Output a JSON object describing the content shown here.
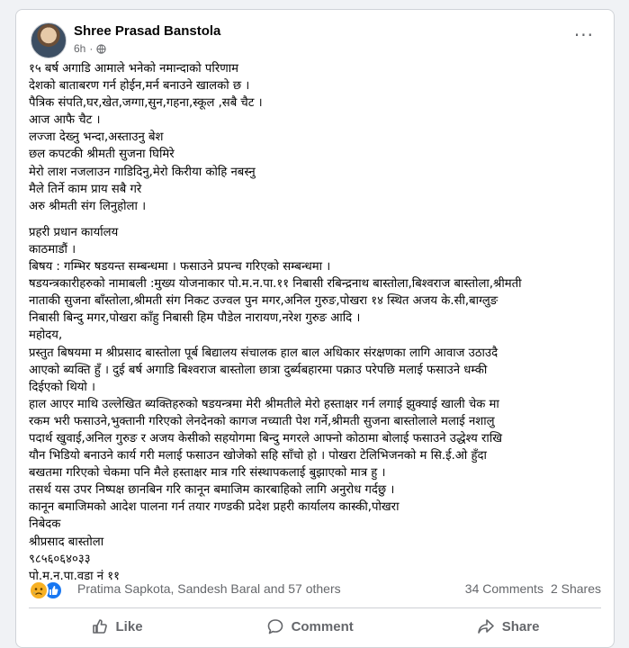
{
  "post": {
    "author": "Shree Prasad Banstola",
    "time": "6h",
    "dot": "·",
    "more": "···",
    "privacy_icon": "globe-icon",
    "lines": [
      "१५ बर्ष अगाडि आमाले भनेको नमान्दाको परिणाम",
      "देशको बाताबरण गर्न होईन,मर्न बनाउने खालको छ ।",
      "पैत्रिक संपति,घर,खेत,जग्गा,सुन,गहना,स्कूल ,सबै चैट ।",
      "आज आफै चैट ।",
      "लज्जा देख्नु भन्दा,अस्ताउनु बेश",
      "छल कपटकी श्रीमती सुजना घिमिरे",
      "मेरो लाश नजलाउन गाडिदिनु,मेरो किरीया कोहि नबस्नु",
      "मैले तिर्ने काम प्राय सबै गरे",
      "अरु श्रीमती संग लिनुहोला ।",
      "",
      "प्रहरी प्रधान कार्यालय",
      "काठमाडौं ।",
      "बिषय : गम्भिर षडयन्त सम्बन्धमा । फसाउने प्रपन्च गरिएको सम्बन्धमा ।",
      "षडयन्त्रकारीहरुको नामाबली :मुख्य योजनाकार पो.म.न.पा.११ निबासी रबिन्द्रनाथ बास्तोला,बिश्वराज बास्तोला,श्रीमती",
      "नाताकी सुजना बाँस्तोला,श्रीमती संग निकट उज्वल पुन मगर,अनिल गुरुङ,पोखरा १४ स्थित अजय के.सी,बाग्लुङ",
      "निबासी बिन्दु मगर,पोखरा काँहु निबासी हिम पौडेल नारायण,नरेश गुरुङ आदि ।",
      "महोदय,",
      "प्रस्तुत बिषयमा म श्रीप्रसाद बास्तोला पूर्ब बिद्यालय संचालक हाल बाल अधिकार संरक्षणका लागि आवाज उठाउदै",
      "आएको ब्यक्ति हुँ । दुई बर्ष अगाडि बिश्वराज बास्तोला छात्रा दुर्ब्यबहारमा पक्राउ परेपछि मलाई फसाउने धम्की",
      "दिईएको थियो ।",
      "हाल आएर माथि उल्लेखित ब्यक्तिहरुको षडयन्त्रमा मेरी श्रीमतीले मेरो हस्ताक्षर गर्न लगाई झुक्याई खाली चेक मा",
      "रकम भरी फसाउने,भुक्तानी गरिएको लेनदेनको कागज नच्याती पेश गर्ने,श्रीमती सुजना बास्तोलाले मलाई नशालु",
      "पदार्थ खुवाई,अनिल गुरुङ र अजय केसीको सहयोगमा बिन्दु मगरले आफ्नो कोठामा बोलाई फसाउने उद्धेश्य राखि",
      "यौन भिडियो बनाउने कार्य गरी मलाई फसाउन खोजेको सहि साँचो हो । पोखरा टेलिभिजनको म सि.ई.ओ हुँदा",
      "बखतमा गरिएको चेकमा पनि मैले हस्ताक्षर मात्र गरि संस्थापकलाई बुझाएको मात्र हु ।",
      "तसर्थ यस उपर निष्पक्ष छानबिन गरि कानून बमाजिम कारबाहिको लागि अनुरोध गर्दछु ।",
      "कानून बमाजिमको आदेश पालना गर्न तयार गण्डकी प्रदेश प्रहरी कार्यालय कास्की,पोखरा",
      "निबेदक",
      "श्रीप्रसाद बास्तोला",
      "९८५६०६४०३३",
      "पो.म.न.पा.वडा नं ११"
    ]
  },
  "reactions": {
    "names": "Pratima Sapkota, Sandesh Baral and 57 others",
    "comments": "34 Comments",
    "shares": "2 Shares",
    "icons": [
      "sad-reaction-icon",
      "like-reaction-icon"
    ]
  },
  "actions": {
    "like": "Like",
    "comment": "Comment",
    "share": "Share"
  },
  "colors": {
    "background": "#f0f2f5",
    "card": "#ffffff",
    "text": "#050505",
    "secondary": "#65676b",
    "like_blue": "#1877f2",
    "sad_yellow": "#f7b125"
  }
}
